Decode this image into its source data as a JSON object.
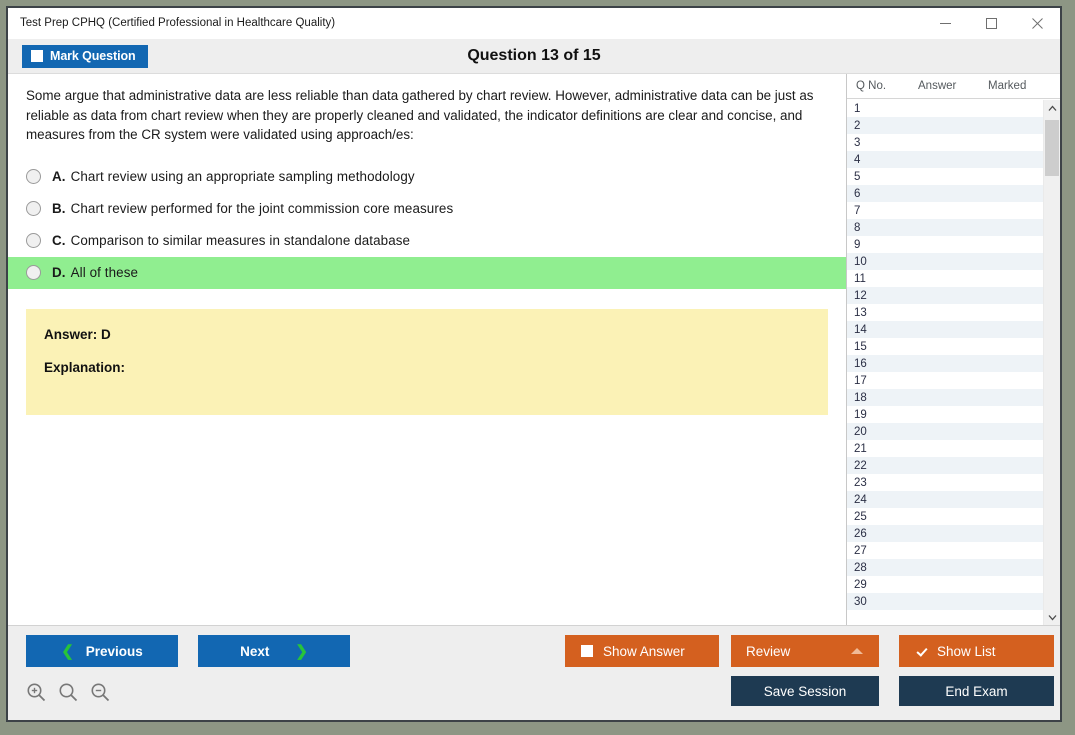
{
  "window": {
    "title": "Test Prep CPHQ (Certified Professional in Healthcare Quality)",
    "minimize_icon": "minimize-icon",
    "maximize_icon": "maximize-icon",
    "close_icon": "close-icon"
  },
  "header": {
    "mark_question_label": "Mark Question",
    "mark_question_checked": false,
    "question_counter": "Question 13 of 15"
  },
  "question": {
    "text": "Some argue that administrative data are less reliable than data gathered by chart review. However, administrative data can be just as reliable as data from chart review when they are properly cleaned and validated, the indicator definitions are clear and concise, and measures from the CR system were validated using approach/es:",
    "options": [
      {
        "letter": "A.",
        "text": "Chart review using an appropriate sampling methodology",
        "selected": false,
        "correct": false
      },
      {
        "letter": "B.",
        "text": "Chart review performed for the joint commission core measures",
        "selected": false,
        "correct": false
      },
      {
        "letter": "C.",
        "text": "Comparison to similar measures in standalone database",
        "selected": false,
        "correct": false
      },
      {
        "letter": "D.",
        "text": "All of these",
        "selected": false,
        "correct": true
      }
    ]
  },
  "answer_panel": {
    "answer_label": "Answer: D",
    "explanation_label": "Explanation:",
    "background_color": "#fbf2b6"
  },
  "question_list": {
    "columns": [
      "Q No.",
      "Answer",
      "Marked"
    ],
    "rows": [
      {
        "qno": "1",
        "answer": "",
        "marked": ""
      },
      {
        "qno": "2",
        "answer": "",
        "marked": ""
      },
      {
        "qno": "3",
        "answer": "",
        "marked": ""
      },
      {
        "qno": "4",
        "answer": "",
        "marked": ""
      },
      {
        "qno": "5",
        "answer": "",
        "marked": ""
      },
      {
        "qno": "6",
        "answer": "",
        "marked": ""
      },
      {
        "qno": "7",
        "answer": "",
        "marked": ""
      },
      {
        "qno": "8",
        "answer": "",
        "marked": ""
      },
      {
        "qno": "9",
        "answer": "",
        "marked": ""
      },
      {
        "qno": "10",
        "answer": "",
        "marked": ""
      },
      {
        "qno": "11",
        "answer": "",
        "marked": ""
      },
      {
        "qno": "12",
        "answer": "",
        "marked": ""
      },
      {
        "qno": "13",
        "answer": "",
        "marked": ""
      },
      {
        "qno": "14",
        "answer": "",
        "marked": ""
      },
      {
        "qno": "15",
        "answer": "",
        "marked": ""
      },
      {
        "qno": "16",
        "answer": "",
        "marked": ""
      },
      {
        "qno": "17",
        "answer": "",
        "marked": ""
      },
      {
        "qno": "18",
        "answer": "",
        "marked": ""
      },
      {
        "qno": "19",
        "answer": "",
        "marked": ""
      },
      {
        "qno": "20",
        "answer": "",
        "marked": ""
      },
      {
        "qno": "21",
        "answer": "",
        "marked": ""
      },
      {
        "qno": "22",
        "answer": "",
        "marked": ""
      },
      {
        "qno": "23",
        "answer": "",
        "marked": ""
      },
      {
        "qno": "24",
        "answer": "",
        "marked": ""
      },
      {
        "qno": "25",
        "answer": "",
        "marked": ""
      },
      {
        "qno": "26",
        "answer": "",
        "marked": ""
      },
      {
        "qno": "27",
        "answer": "",
        "marked": ""
      },
      {
        "qno": "28",
        "answer": "",
        "marked": ""
      },
      {
        "qno": "29",
        "answer": "",
        "marked": ""
      },
      {
        "qno": "30",
        "answer": "",
        "marked": ""
      }
    ],
    "scroll_up_icon": "chevron-up-icon",
    "scroll_down_icon": "chevron-down-icon"
  },
  "footer": {
    "previous_label": "Previous",
    "next_label": "Next",
    "show_answer_label": "Show Answer",
    "show_answer_checked": false,
    "review_label": "Review",
    "show_list_label": "Show List",
    "show_list_checked": true,
    "save_session_label": "Save Session",
    "end_exam_label": "End Exam",
    "zoom_in_icon": "zoom-in-icon",
    "zoom_reset_icon": "zoom-reset-icon",
    "zoom_out_icon": "zoom-out-icon"
  },
  "colors": {
    "primary_blue": "#1267b2",
    "accent_orange": "#d4601f",
    "navy": "#1e3a52",
    "correct_green": "#90ee90",
    "answer_yellow": "#fbf2b6"
  }
}
